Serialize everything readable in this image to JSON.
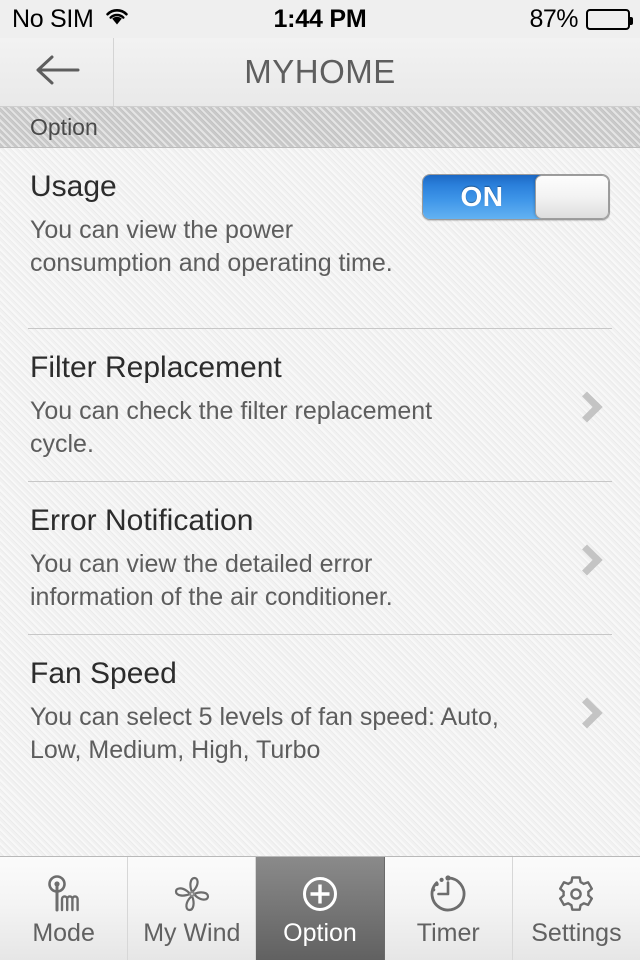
{
  "status_bar": {
    "carrier": "No SIM",
    "wifi_icon": "wifi-icon",
    "time": "1:44 PM",
    "battery_percent": "87%",
    "battery_level": 87,
    "battery_icon": "battery-icon"
  },
  "nav_bar": {
    "back_icon": "back-arrow-icon",
    "title": "MYHOME"
  },
  "section": {
    "header": "Option"
  },
  "rows": [
    {
      "title": "Usage",
      "description": "You can view the power consumption and operating time.",
      "control": "switch",
      "switch_label": "ON",
      "switch_state": "on"
    },
    {
      "title": "Filter Replacement",
      "description": "You can check the filter replacement cycle.",
      "control": "chevron"
    },
    {
      "title": "Error Notification",
      "description": "You can view the detailed error information of the air conditioner.",
      "control": "chevron"
    },
    {
      "title": "Fan Speed",
      "description": "You can select 5 levels of fan speed: Auto, Low, Medium, High, Turbo",
      "control": "chevron"
    }
  ],
  "tab_bar": {
    "active_index": 2,
    "tabs": [
      {
        "label": "Mode",
        "icon": "thermometer-mode-icon"
      },
      {
        "label": "My Wind",
        "icon": "fan-blades-icon"
      },
      {
        "label": "Option",
        "icon": "plus-circle-icon"
      },
      {
        "label": "Timer",
        "icon": "clock-timer-icon"
      },
      {
        "label": "Settings",
        "icon": "gear-icon"
      }
    ]
  },
  "colors": {
    "switch_on_blue": "#2a7fda",
    "section_header_bg": "#c9c9c9",
    "page_bg": "#f1f1f1",
    "active_tab_bg": "#787878",
    "title_text": "#2c2c2c",
    "desc_text": "#5d5d5d",
    "chevron": "#c4c4c4"
  }
}
